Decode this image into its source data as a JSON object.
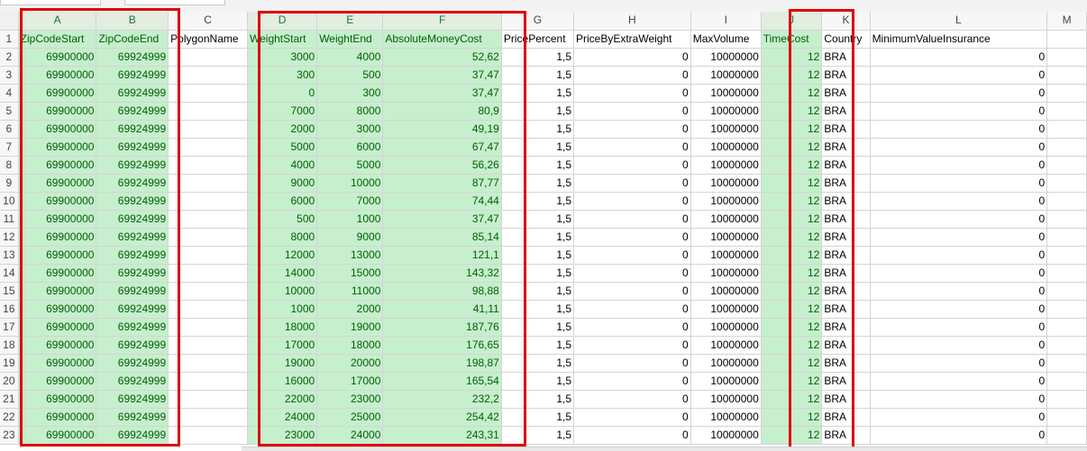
{
  "columns": [
    "A",
    "B",
    "C",
    "D",
    "E",
    "F",
    "G",
    "H",
    "I",
    "J",
    "K",
    "L",
    "M"
  ],
  "header_row": [
    "ZipCodeStart",
    "ZipCodeEnd",
    "PolygonName",
    "WeightStart",
    "WeightEnd",
    "AbsoluteMoneyCost",
    "PricePercent",
    "PriceByExtraWeight",
    "MaxVolume",
    "TimeCost",
    "Country",
    "MinimumValueInsurance",
    ""
  ],
  "rows": [
    [
      "69900000",
      "69924999",
      "",
      "3000",
      "4000",
      "52,62",
      "1,5",
      "0",
      "10000000",
      "12",
      "BRA",
      "0"
    ],
    [
      "69900000",
      "69924999",
      "",
      "300",
      "500",
      "37,47",
      "1,5",
      "0",
      "10000000",
      "12",
      "BRA",
      "0"
    ],
    [
      "69900000",
      "69924999",
      "",
      "0",
      "300",
      "37,47",
      "1,5",
      "0",
      "10000000",
      "12",
      "BRA",
      "0"
    ],
    [
      "69900000",
      "69924999",
      "",
      "7000",
      "8000",
      "80,9",
      "1,5",
      "0",
      "10000000",
      "12",
      "BRA",
      "0"
    ],
    [
      "69900000",
      "69924999",
      "",
      "2000",
      "3000",
      "49,19",
      "1,5",
      "0",
      "10000000",
      "12",
      "BRA",
      "0"
    ],
    [
      "69900000",
      "69924999",
      "",
      "5000",
      "6000",
      "67,47",
      "1,5",
      "0",
      "10000000",
      "12",
      "BRA",
      "0"
    ],
    [
      "69900000",
      "69924999",
      "",
      "4000",
      "5000",
      "56,26",
      "1,5",
      "0",
      "10000000",
      "12",
      "BRA",
      "0"
    ],
    [
      "69900000",
      "69924999",
      "",
      "9000",
      "10000",
      "87,77",
      "1,5",
      "0",
      "10000000",
      "12",
      "BRA",
      "0"
    ],
    [
      "69900000",
      "69924999",
      "",
      "6000",
      "7000",
      "74,44",
      "1,5",
      "0",
      "10000000",
      "12",
      "BRA",
      "0"
    ],
    [
      "69900000",
      "69924999",
      "",
      "500",
      "1000",
      "37,47",
      "1,5",
      "0",
      "10000000",
      "12",
      "BRA",
      "0"
    ],
    [
      "69900000",
      "69924999",
      "",
      "8000",
      "9000",
      "85,14",
      "1,5",
      "0",
      "10000000",
      "12",
      "BRA",
      "0"
    ],
    [
      "69900000",
      "69924999",
      "",
      "12000",
      "13000",
      "121,1",
      "1,5",
      "0",
      "10000000",
      "12",
      "BRA",
      "0"
    ],
    [
      "69900000",
      "69924999",
      "",
      "14000",
      "15000",
      "143,32",
      "1,5",
      "0",
      "10000000",
      "12",
      "BRA",
      "0"
    ],
    [
      "69900000",
      "69924999",
      "",
      "10000",
      "11000",
      "98,88",
      "1,5",
      "0",
      "10000000",
      "12",
      "BRA",
      "0"
    ],
    [
      "69900000",
      "69924999",
      "",
      "1000",
      "2000",
      "41,11",
      "1,5",
      "0",
      "10000000",
      "12",
      "BRA",
      "0"
    ],
    [
      "69900000",
      "69924999",
      "",
      "18000",
      "19000",
      "187,76",
      "1,5",
      "0",
      "10000000",
      "12",
      "BRA",
      "0"
    ],
    [
      "69900000",
      "69924999",
      "",
      "17000",
      "18000",
      "176,65",
      "1,5",
      "0",
      "10000000",
      "12",
      "BRA",
      "0"
    ],
    [
      "69900000",
      "69924999",
      "",
      "19000",
      "20000",
      "198,87",
      "1,5",
      "0",
      "10000000",
      "12",
      "BRA",
      "0"
    ],
    [
      "69900000",
      "69924999",
      "",
      "16000",
      "17000",
      "165,54",
      "1,5",
      "0",
      "10000000",
      "12",
      "BRA",
      "0"
    ],
    [
      "69900000",
      "69924999",
      "",
      "22000",
      "23000",
      "232,2",
      "1,5",
      "0",
      "10000000",
      "12",
      "BRA",
      "0"
    ],
    [
      "69900000",
      "69924999",
      "",
      "24000",
      "25000",
      "254,42",
      "1,5",
      "0",
      "10000000",
      "12",
      "BRA",
      "0"
    ],
    [
      "69900000",
      "69924999",
      "",
      "23000",
      "24000",
      "243,31",
      "1,5",
      "0",
      "10000000",
      "12",
      "BRA",
      "0"
    ]
  ],
  "colors": {
    "highlight_fill": "#c6efce",
    "highlight_text": "#006100",
    "outline": "#e00000"
  }
}
